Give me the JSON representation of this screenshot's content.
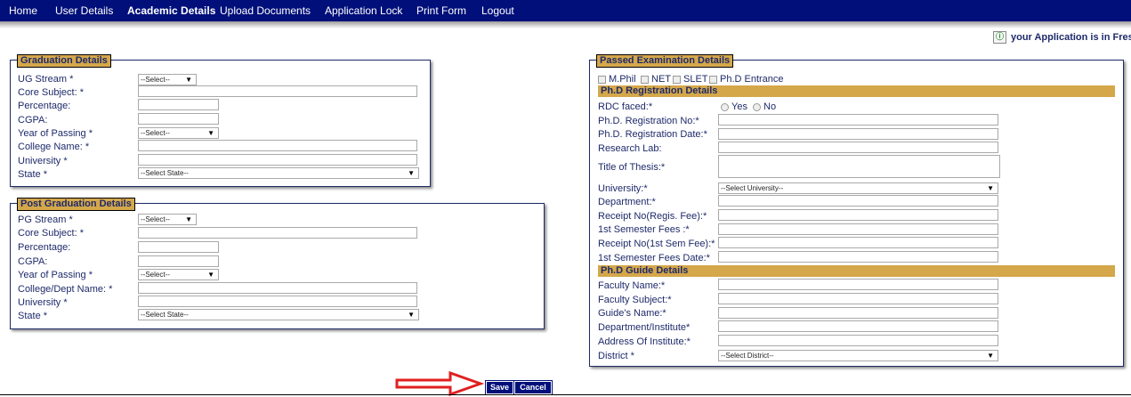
{
  "nav": {
    "items": [
      "Home",
      "User Details",
      "Academic Details",
      "Upload Documents",
      "Application Lock",
      "Print Form",
      "Logout"
    ],
    "active": "Academic Details"
  },
  "status": {
    "text": "your Application is in Fresh",
    "icon": "info-icon"
  },
  "graduation": {
    "legend": "Graduation Details",
    "fields": {
      "ug_stream": "UG Stream *",
      "core_subject": "Core Subject: *",
      "percentage": "Percentage:",
      "cgpa": "CGPA:",
      "year_of_passing": "Year of Passing *",
      "college_name": "College Name: *",
      "university": "University *",
      "state": "State *"
    },
    "selects": {
      "stream": "--Select--",
      "year": "--Select--",
      "state": "--Select State--"
    }
  },
  "post_graduation": {
    "legend": "Post Graduation Details",
    "fields": {
      "pg_stream": "PG Stream *",
      "core_subject": "Core Subject: *",
      "percentage": "Percentage:",
      "cgpa": "CGPA:",
      "year_of_passing": "Year of Passing *",
      "college_dept": "College/Dept Name: *",
      "university": "University *",
      "state": "State *"
    },
    "selects": {
      "stream": "--Select--",
      "year": "--Select--",
      "state": "--Select State--"
    }
  },
  "passed_exam": {
    "legend": "Passed Examination Details",
    "checkboxes": [
      "M.Phil",
      "NET",
      "SLET",
      "Ph.D Entrance"
    ]
  },
  "phd_registration": {
    "header": "Ph.D Registration Details",
    "rdc_label": "RDC faced:*",
    "rdc_options": [
      "Yes",
      "No"
    ],
    "fields": {
      "reg_no": "Ph.D. Registration No:*",
      "reg_date": "Ph.D. Registration Date:*",
      "research_lab": "Research Lab:",
      "thesis_title": "Title of Thesis:*",
      "university": "University:*",
      "department": "Department:*",
      "receipt_reg": "Receipt No(Regis. Fee):*",
      "sem_fees": "1st Semester Fees :*",
      "receipt_sem": "Receipt No(1st Sem Fee):*",
      "sem_fees_date": "1st Semester Fees Date:*"
    },
    "university_select": "--Select University--"
  },
  "phd_guide": {
    "header": "Ph.D Guide Details",
    "fields": {
      "faculty_name": "Faculty Name:*",
      "faculty_subject": "Faculty Subject:*",
      "guide_name": "Guide's Name:*",
      "dept_institute": "Department/Institute*",
      "address_institute": "Address Of Institute:*",
      "district": "District *"
    },
    "district_select": "--Select District--"
  },
  "actions": {
    "save": "Save",
    "cancel": "Cancel"
  },
  "colors": {
    "nav_bg": "#000f7a",
    "legend_bg": "#d4a74a",
    "text": "#1e2a6a",
    "arrow": "#e02020"
  }
}
